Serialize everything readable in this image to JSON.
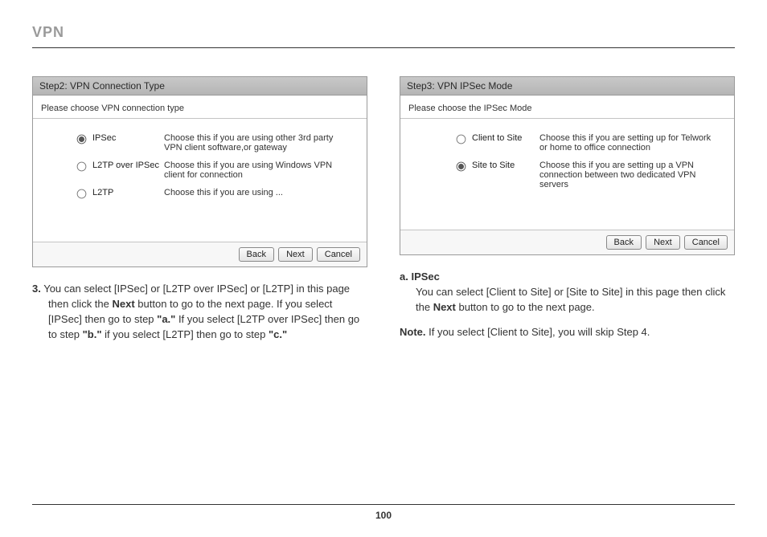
{
  "header": {
    "title": "VPN"
  },
  "left_panel": {
    "title": "Step2: VPN Connection Type",
    "subtitle": "Please choose VPN connection type",
    "options": [
      {
        "label": "IPSec",
        "desc": "Choose this if you are using other 3rd party VPN client software,or gateway",
        "checked": true
      },
      {
        "label": "L2TP over IPSec",
        "desc": "Choose this if you are using Windows VPN client for connection",
        "checked": false
      },
      {
        "label": "L2TP",
        "desc": "Choose this if you are using ...",
        "checked": false
      }
    ],
    "buttons": {
      "back": "Back",
      "next": "Next",
      "cancel": "Cancel"
    }
  },
  "right_panel": {
    "title": "Step3: VPN IPSec Mode",
    "subtitle": "Please choose the IPSec Mode",
    "options": [
      {
        "label": "Client to Site",
        "desc": "Choose this if you are setting up for Telwork or home to office connection",
        "checked": false
      },
      {
        "label": "Site to Site",
        "desc": "Choose this if you are setting up a VPN connection between two dedicated VPN servers",
        "checked": true
      }
    ],
    "buttons": {
      "back": "Back",
      "next": "Next",
      "cancel": "Cancel"
    }
  },
  "left_text": {
    "num": "3.",
    "part1": " You can select [IPSec] or [L2TP over IPSec] or [L2TP] in this page then click the ",
    "bold1": "Next",
    "part2": " button to go to the next page. If you select [IPSec] then go to step ",
    "bold2": "\"a.\"",
    "part3": " If you select [L2TP over IPSec] then go to step ",
    "bold3": "\"b.\"",
    "part4": " if you select [L2TP] then go to step ",
    "bold4": "\"c.\""
  },
  "right_text": {
    "heading": "a. IPSec",
    "part1": "You can select [Client to Site] or [Site to Site] in this page then click the ",
    "bold1": "Next",
    "part2": " button to go to the next page.",
    "note_label": "Note.",
    "note_text": " If you select [Client to Site], you will skip Step 4."
  },
  "footer": {
    "page_number": "100"
  }
}
